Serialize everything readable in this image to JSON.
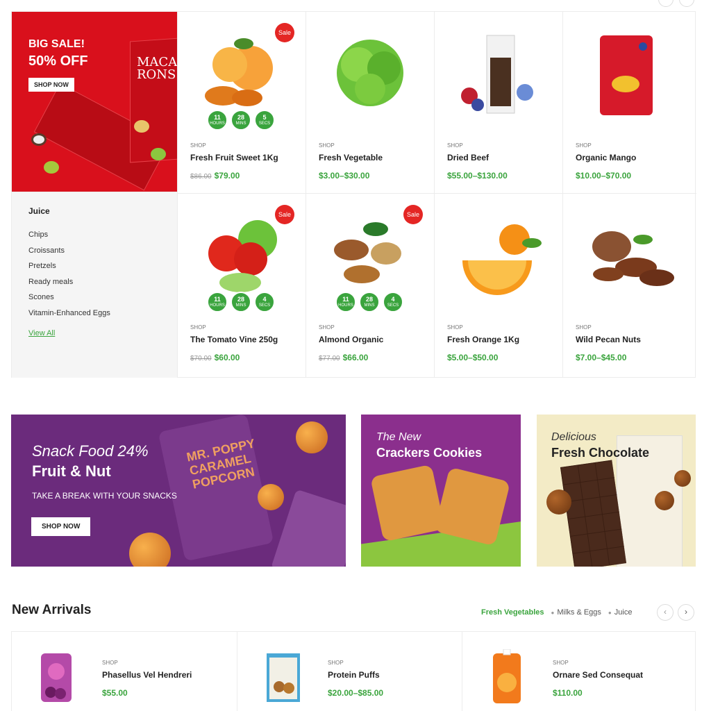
{
  "promo": {
    "line1": "BIG SALE!",
    "line2": "50% OFF",
    "button": "SHOP NOW",
    "box_text": "MACA- RONS"
  },
  "categories": {
    "heading": "Juice",
    "items": [
      "Chips",
      "Croissants",
      "Pretzels",
      "Ready meals",
      "Scones",
      "Vitamin-Enhanced Eggs"
    ],
    "view_all": "View All"
  },
  "products": [
    {
      "shop": "SHOP",
      "name": "Fresh Fruit Sweet 1Kg",
      "old_price": "$86.00",
      "price": "$79.00",
      "sale": "Sale",
      "timer": {
        "hours": "11",
        "mins": "28",
        "secs": "5"
      }
    },
    {
      "shop": "SHOP",
      "name": "Fresh Vegetable",
      "old_price": "",
      "price": "$3.00–$30.00",
      "sale": "",
      "timer": null
    },
    {
      "shop": "SHOP",
      "name": "Dried Beef",
      "old_price": "",
      "price": "$55.00–$130.00",
      "sale": "",
      "timer": null
    },
    {
      "shop": "SHOP",
      "name": "Organic Mango",
      "old_price": "",
      "price": "$10.00–$70.00",
      "sale": "",
      "timer": null
    },
    {
      "shop": "SHOP",
      "name": "The Tomato Vine 250g",
      "old_price": "$70.00",
      "price": "$60.00",
      "sale": "Sale",
      "timer": {
        "hours": "11",
        "mins": "28",
        "secs": "4"
      }
    },
    {
      "shop": "SHOP",
      "name": "Almond Organic",
      "old_price": "$77.00",
      "price": "$66.00",
      "sale": "Sale",
      "timer": {
        "hours": "11",
        "mins": "28",
        "secs": "4"
      }
    },
    {
      "shop": "SHOP",
      "name": "Fresh Orange 1Kg",
      "old_price": "",
      "price": "$5.00–$50.00",
      "sale": "",
      "timer": null
    },
    {
      "shop": "SHOP",
      "name": "Wild Pecan Nuts",
      "old_price": "",
      "price": "$7.00–$45.00",
      "sale": "",
      "timer": null
    }
  ],
  "timer_labels": {
    "hours": "HOURS",
    "mins": "MINS",
    "secs": "SECS"
  },
  "banners": {
    "snack": {
      "line1": "Snack Food 24%",
      "line2": "Fruit & Nut",
      "line3": "TAKE A BREAK WITH YOUR SNACKS",
      "button": "SHOP NOW",
      "bag_text": "MR. POPPY CARAMEL POPCORN"
    },
    "crackers": {
      "line1": "The New",
      "line2": "Crackers Cookies"
    },
    "chocolate": {
      "line1": "Delicious",
      "line2": "Fresh Chocolate"
    }
  },
  "new_arrivals": {
    "title": "New Arrivals",
    "tabs": [
      {
        "label": "Fresh Vegetables",
        "active": true
      },
      {
        "label": "Milks & Eggs",
        "active": false
      },
      {
        "label": "Juice",
        "active": false
      }
    ],
    "prev_icon": "‹",
    "next_icon": "›",
    "items": [
      {
        "shop": "SHOP",
        "name": "Phasellus Vel Hendreri",
        "price": "$55.00"
      },
      {
        "shop": "SHOP",
        "name": "Protein Puffs",
        "price": "$20.00–$85.00"
      },
      {
        "shop": "SHOP",
        "name": "Ornare Sed Consequat",
        "price": "$110.00"
      }
    ]
  },
  "colors": {
    "accent_green": "#3aa43d",
    "sale_red": "#e42624",
    "promo_red": "#d9101c"
  }
}
